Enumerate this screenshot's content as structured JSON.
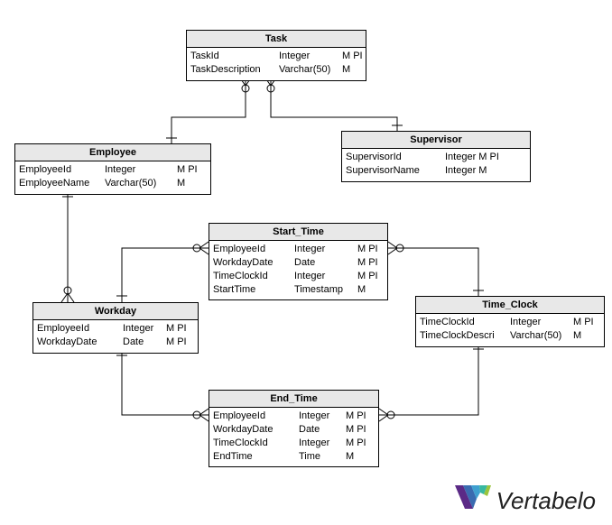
{
  "entities": {
    "task": {
      "title": "Task",
      "rows": [
        {
          "name": "TaskId",
          "type": "Integer",
          "flags": "M PI"
        },
        {
          "name": "TaskDescription",
          "type": "Varchar(50)",
          "flags": "M"
        }
      ]
    },
    "employee": {
      "title": "Employee",
      "rows": [
        {
          "name": "EmployeeId",
          "type": "Integer",
          "flags": "M PI"
        },
        {
          "name": "EmployeeName",
          "type": "Varchar(50)",
          "flags": "M"
        }
      ]
    },
    "supervisor": {
      "title": "Supervisor",
      "rows": [
        {
          "name": "SupervisorId",
          "type": "Integer M PI",
          "flags": ""
        },
        {
          "name": "SupervisorName",
          "type": "Integer M",
          "flags": ""
        }
      ]
    },
    "start_time": {
      "title": "Start_Time",
      "rows": [
        {
          "name": "EmployeeId",
          "type": "Integer",
          "flags": "M PI"
        },
        {
          "name": "WorkdayDate",
          "type": "Date",
          "flags": "M PI"
        },
        {
          "name": "TimeClockId",
          "type": "Integer",
          "flags": "M PI"
        },
        {
          "name": "StartTime",
          "type": "Timestamp",
          "flags": "M"
        }
      ]
    },
    "workday": {
      "title": "Workday",
      "rows": [
        {
          "name": "EmployeeId",
          "type": "Integer",
          "flags": "M PI"
        },
        {
          "name": "WorkdayDate",
          "type": "Date",
          "flags": "M PI"
        }
      ]
    },
    "time_clock": {
      "title": "Time_Clock",
      "rows": [
        {
          "name": "TimeClockId",
          "type": "Integer",
          "flags": "M PI"
        },
        {
          "name": "TimeClockDescri",
          "type": "Varchar(50)",
          "flags": "M"
        }
      ]
    },
    "end_time": {
      "title": "End_Time",
      "rows": [
        {
          "name": "EmployeeId",
          "type": "Integer",
          "flags": "M PI"
        },
        {
          "name": "WorkdayDate",
          "type": "Date",
          "flags": "M PI"
        },
        {
          "name": "TimeClockId",
          "type": "Integer",
          "flags": "M PI"
        },
        {
          "name": "EndTime",
          "type": "Time",
          "flags": "M"
        }
      ]
    }
  },
  "logo_text": "Vertabelo"
}
